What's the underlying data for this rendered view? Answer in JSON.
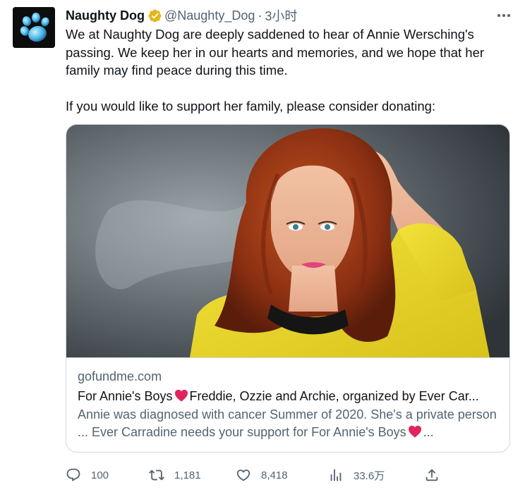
{
  "author": {
    "display_name": "Naughty Dog",
    "handle": "@Naughty_Dog",
    "separator": "·",
    "time": "3小时"
  },
  "tweet": {
    "paragraph1": "We at Naughty Dog are deeply saddened to hear of Annie Wersching's passing. We keep her in our hearts and memories, and we hope that her family may find peace during this time.",
    "paragraph2": "If you would like to support her family, please consider donating:"
  },
  "card": {
    "domain": "gofundme.com",
    "title_before": "For Annie's Boys",
    "title_after": "Freddie, Ozzie and Archie, organized by Ever Car...",
    "desc_before": "Annie was diagnosed with cancer Summer of 2020. She's a private person ... Ever Carradine needs your support for For Annie's Boys",
    "desc_after": "..."
  },
  "actions": {
    "replies": "100",
    "retweets": "1,181",
    "likes": "8,418",
    "views": "33.6万"
  },
  "colors": {
    "text_primary": "#0f1419",
    "text_secondary": "#536471",
    "verified_gold": "#e2b719",
    "heart_red": "#e0245e",
    "border": "#cfd9de"
  },
  "icons": {
    "avatar": "paw-logo-icon",
    "verified": "verified-badge-icon",
    "more": "more-dots-icon",
    "reply": "reply-icon",
    "retweet": "retweet-icon",
    "like": "like-icon",
    "views": "views-icon",
    "share": "share-icon",
    "heart_emoji": "red-heart-icon"
  }
}
